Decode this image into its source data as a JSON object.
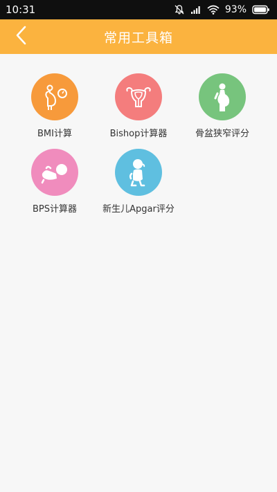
{
  "status_bar": {
    "time": "10:31",
    "battery": "93%",
    "icons": [
      "bell-muted-icon",
      "signal-icon",
      "wifi-icon",
      "battery-icon"
    ]
  },
  "app_bar": {
    "title": "常用工具箱",
    "back_icon": "chevron-left-icon",
    "background": "#fbb33f"
  },
  "tools": [
    {
      "label": "BMI计算",
      "icon": "pregnant-scale-icon",
      "color": "#f79a3b"
    },
    {
      "label": "Bishop计算器",
      "icon": "uterus-icon",
      "color": "#f47d7d"
    },
    {
      "label": "骨盆狭窄评分",
      "icon": "pregnant-silhouette-icon",
      "color": "#77c47d"
    },
    {
      "label": "BPS计算器",
      "icon": "fetus-icon",
      "color": "#f08cbd"
    },
    {
      "label": "新生儿Apgar评分",
      "icon": "baby-icon",
      "color": "#5fbfe0"
    }
  ]
}
